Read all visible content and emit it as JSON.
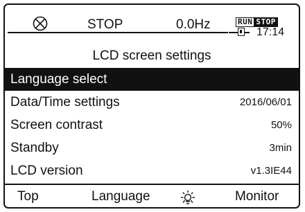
{
  "status": {
    "mode": "STOP",
    "frequency": "0.0Hz",
    "run_label": "RUN",
    "stop_label": "STOP",
    "time": "17:14",
    "icons": [
      "stop-circle-icon",
      "battery-icon"
    ]
  },
  "screen": {
    "title": "LCD screen settings"
  },
  "menu": {
    "items": [
      {
        "label": "Language select",
        "value": "",
        "selected": true
      },
      {
        "label": "Data/Time settings",
        "value": "2016/06/01"
      },
      {
        "label": "Screen contrast",
        "value": "50%"
      },
      {
        "label": "Standby",
        "value": "3min"
      },
      {
        "label": "LCD version",
        "value": "v1.3IE44"
      }
    ]
  },
  "fkeys": {
    "f1": "Top",
    "f2": "Language",
    "f3_icon": "sun-icon",
    "f4": "Monitor"
  },
  "colors": {
    "foreground": "#111111",
    "background": "#ffffff"
  }
}
